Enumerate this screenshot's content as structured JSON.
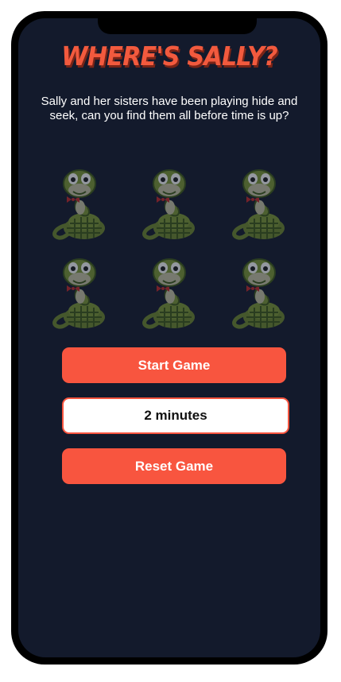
{
  "game": {
    "title": "WHERE'S SALLY?",
    "intro": "Sally and her sisters have been playing hide and seek, can you find them all before time is up?",
    "snake_count": 6,
    "snake_icon": "snake-icon"
  },
  "controls": {
    "start_label": "Start Game",
    "duration_value": "2 minutes",
    "reset_label": "Reset Game"
  },
  "colors": {
    "background": "#131a2c",
    "accent": "#f8553f",
    "title": "#f25a3e"
  }
}
